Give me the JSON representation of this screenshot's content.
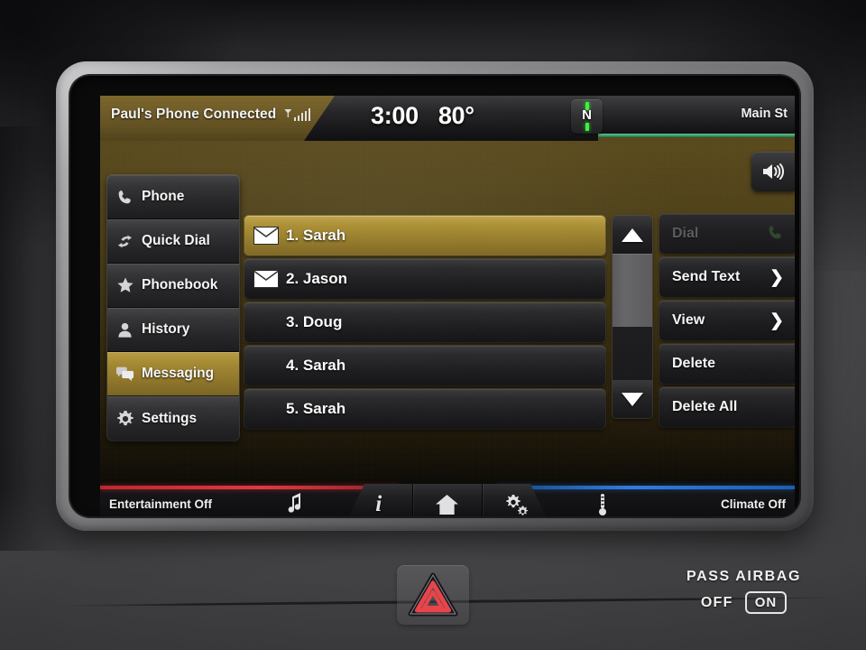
{
  "header": {
    "phone_status": "Paul's Phone Connected",
    "signal_icon": "signal-bars-icon",
    "time": "3:00",
    "temperature": "80°",
    "compass_heading": "N",
    "street": "Main St",
    "volume_icon": "speaker-volume-icon"
  },
  "sidebar": {
    "items": [
      {
        "label": "Phone",
        "icon": "phone-handset-icon",
        "active": false
      },
      {
        "label": "Quick Dial",
        "icon": "quick-dial-arrows-icon",
        "active": false
      },
      {
        "label": "Phonebook",
        "icon": "star-icon",
        "active": false
      },
      {
        "label": "History",
        "icon": "person-icon",
        "active": false
      },
      {
        "label": "Messaging",
        "icon": "speech-bubbles-icon",
        "active": true
      },
      {
        "label": "Settings",
        "icon": "gear-icon",
        "active": false
      }
    ]
  },
  "message_list": {
    "rows": [
      {
        "label": "1. Sarah",
        "unread": true,
        "selected": true
      },
      {
        "label": "2. Jason",
        "unread": true,
        "selected": false
      },
      {
        "label": "3. Doug",
        "unread": false,
        "selected": false
      },
      {
        "label": "4. Sarah",
        "unread": false,
        "selected": false
      },
      {
        "label": "5. Sarah",
        "unread": false,
        "selected": false
      }
    ]
  },
  "scrollbar": {
    "up_icon": "triangle-up-icon",
    "down_icon": "triangle-down-icon",
    "thumb_position_percent": 0
  },
  "actions": {
    "buttons": [
      {
        "label": "Dial",
        "chevron": "",
        "disabled": true,
        "icon": "phone-handset-icon"
      },
      {
        "label": "Send Text",
        "chevron": "❯",
        "disabled": false,
        "icon": ""
      },
      {
        "label": "View",
        "chevron": "❯",
        "disabled": false,
        "icon": ""
      },
      {
        "label": "Delete",
        "chevron": "",
        "disabled": false,
        "icon": ""
      },
      {
        "label": "Delete All",
        "chevron": "",
        "disabled": false,
        "icon": ""
      }
    ]
  },
  "bottom_bar": {
    "entertainment": "Entertainment Off",
    "climate": "Climate Off",
    "music_icon": "music-note-icon",
    "thermometer_icon": "thermometer-icon",
    "center_buttons": [
      {
        "icon": "info-icon",
        "glyph": "i"
      },
      {
        "icon": "home-icon",
        "glyph": ""
      },
      {
        "icon": "gears-icon",
        "glyph": ""
      }
    ]
  },
  "dashboard": {
    "hazard_icon": "hazard-triangle-icon",
    "airbag_title": "PASS AIRBAG",
    "airbag_off": "OFF",
    "airbag_on": "ON"
  },
  "colors": {
    "accent_gold": "#a3882f",
    "entertainment_red": "#d8353b",
    "climate_blue": "#2f7de0",
    "compass_green": "#3cf33c",
    "horizon_green": "#3da06c"
  }
}
